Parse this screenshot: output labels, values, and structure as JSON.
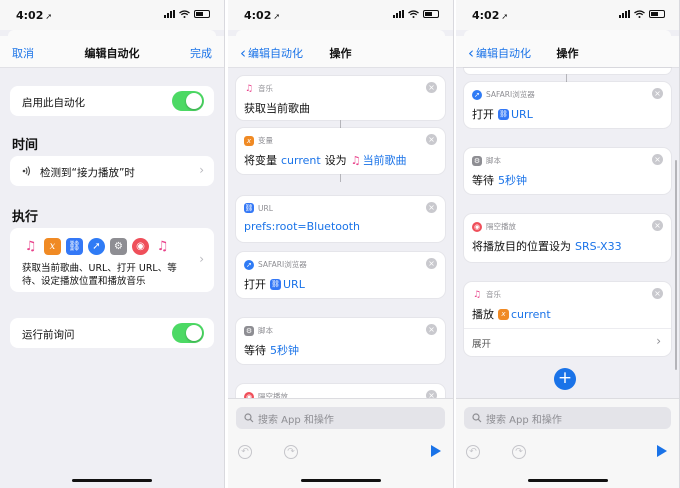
{
  "status": {
    "time": "4:02",
    "location_glyph": "➚"
  },
  "screen1": {
    "nav": {
      "cancel": "取消",
      "title": "编辑自动化",
      "done": "完成"
    },
    "enable_label": "启用此自动化",
    "time_header": "时间",
    "trigger_text": "检测到“接力播放”时",
    "execute_header": "执行",
    "execute_summary_line1": "获取当前歌曲、URL、打开 URL、等",
    "execute_summary_line2": "待、设定播放位置和播放音乐",
    "ask_label": "运行前询问",
    "icons": [
      "music-icon",
      "variable-icon",
      "url-icon",
      "safari-icon",
      "script-icon",
      "airplay-icon",
      "music-icon"
    ]
  },
  "screen2": {
    "nav": {
      "back": "编辑自动化",
      "title": "操作"
    },
    "cards": [
      {
        "category": "音乐",
        "text": "获取当前歌曲"
      },
      {
        "category": "变量",
        "text_a": "将变量",
        "token_a": "current",
        "text_b": "设为",
        "token_b": "当前歌曲"
      },
      {
        "category": "URL",
        "token": "prefs:root=Bluetooth"
      },
      {
        "category": "SAFARI浏览器",
        "text": "打开",
        "token": "URL"
      },
      {
        "category": "脚本",
        "text": "等待",
        "token": "5秒钟"
      },
      {
        "category": "隔空播放"
      }
    ],
    "search_placeholder": "搜索 App 和操作"
  },
  "screen3": {
    "nav": {
      "back": "编辑自动化",
      "title": "操作"
    },
    "cards": [
      {
        "category": "SAFARI浏览器",
        "text": "打开",
        "token": "URL"
      },
      {
        "category": "脚本",
        "text": "等待",
        "token": "5秒钟"
      },
      {
        "category": "隔空播放",
        "text": "将播放目的位置设为",
        "token": "SRS-X33"
      },
      {
        "category": "音乐",
        "text": "播放",
        "token": "current",
        "expand": "展开"
      }
    ],
    "search_placeholder": "搜索 App 和操作"
  },
  "colors": {
    "accent": "#1a73e8",
    "toggle_on": "#4cd964",
    "background": "#efeff4"
  }
}
